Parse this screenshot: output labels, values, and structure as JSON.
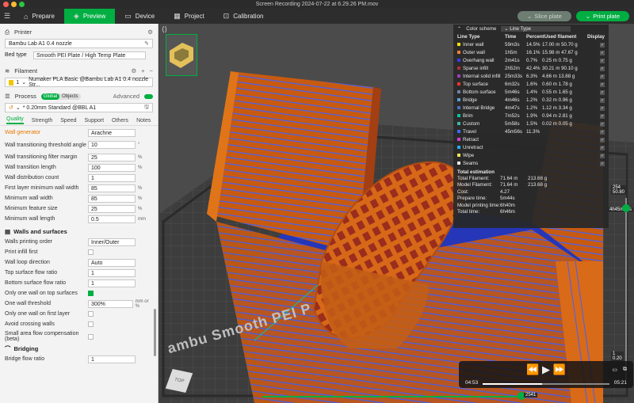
{
  "window": {
    "title": "Screen Recording 2024-07-22 at 6.29.26 PM.mov"
  },
  "tabs": [
    {
      "label": "Prepare",
      "icon": "home-icon"
    },
    {
      "label": "Preview",
      "icon": "cube-icon"
    },
    {
      "label": "Device",
      "icon": "monitor-icon"
    },
    {
      "label": "Project",
      "icon": "project-icon"
    },
    {
      "label": "Calibration",
      "icon": "calibration-icon"
    }
  ],
  "toolbar": {
    "slice_label": "Slice plate",
    "print_label": "Print plate"
  },
  "left": {
    "printer_title": "Printer",
    "printer_value": "Bambu Lab A1 0.4 nozzle",
    "bed_label": "Bed type",
    "bed_value": "Smooth PEI Plate / High Temp Plate",
    "filament_title": "Filament",
    "filament_index": "1",
    "filament_value": "Numaker PLA Basic @Bambu Lab A1 0.4 nozzle Str...",
    "process_title": "Process",
    "process_global": "Global",
    "process_objects": "Objects",
    "advanced": "Advanced",
    "process_profile": "* 0.20mm Standard @BBL A1",
    "subtabs": [
      "Quality",
      "Strength",
      "Speed",
      "Support",
      "Others",
      "Notes"
    ],
    "rows": [
      {
        "label": "Wall generator",
        "value": "Arachne",
        "unit": ""
      },
      {
        "label": "Wall transitioning threshold angle",
        "value": "10",
        "unit": "°"
      },
      {
        "label": "Wall transitioning filter margin",
        "value": "25",
        "unit": "%"
      },
      {
        "label": "Wall transition length",
        "value": "100",
        "unit": "%"
      },
      {
        "label": "Wall distribution count",
        "value": "1",
        "unit": ""
      },
      {
        "label": "First layer minimum wall width",
        "value": "85",
        "unit": "%"
      },
      {
        "label": "Minimum wall width",
        "value": "85",
        "unit": "%"
      },
      {
        "label": "Minimum feature size",
        "value": "25",
        "unit": "%"
      },
      {
        "label": "Minimum wall length",
        "value": "0.5",
        "unit": "mm"
      }
    ],
    "walls_title": "Walls and surfaces",
    "walls_rows": [
      {
        "label": "Walls printing order",
        "value": "Inner/Outer",
        "unit": ""
      },
      {
        "label": "Print infill first",
        "value": "",
        "unit": ""
      },
      {
        "label": "Wall loop direction",
        "value": "Auto",
        "unit": ""
      },
      {
        "label": "Top surface flow ratio",
        "value": "1",
        "unit": ""
      },
      {
        "label": "Bottom surface flow ratio",
        "value": "1",
        "unit": ""
      },
      {
        "label": "Only one wall on top surfaces",
        "value": "",
        "unit": ""
      },
      {
        "label": "One wall threshold",
        "value": "300%",
        "unit": "mm or %"
      },
      {
        "label": "Only one wall on first layer",
        "value": "",
        "unit": ""
      },
      {
        "label": "Avoid crossing walls",
        "value": "",
        "unit": ""
      },
      {
        "label": "Small area flow compensation (beta)",
        "value": "",
        "unit": ""
      }
    ],
    "bridging_title": "Bridging",
    "bridge_flow_label": "Bridge flow ratio",
    "bridge_flow_value": "1"
  },
  "legend": {
    "color_scheme_label": "Color scheme",
    "color_scheme_value": "Line Type",
    "cols": [
      "Line Type",
      "Time",
      "Percent",
      "Used filament",
      "Display"
    ],
    "rows": [
      {
        "name": "Inner wall",
        "time": "59m3s",
        "pct": "14.5%",
        "len": "17.00 m",
        "wt": "50.70 g",
        "color": "#ffe100"
      },
      {
        "name": "Outer wall",
        "time": "1h5m",
        "pct": "16.1%",
        "len": "15.98 m",
        "wt": "47.67 g",
        "color": "#ff7d38"
      },
      {
        "name": "Overhang wall",
        "time": "2m41s",
        "pct": "0.7%",
        "len": "0.25 m",
        "wt": "0.75 g",
        "color": "#3b3bff"
      },
      {
        "name": "Sparse infill",
        "time": "2h52m",
        "pct": "42.4%",
        "len": "30.21 m",
        "wt": "90.10 g",
        "color": "#b0312f"
      },
      {
        "name": "Internal solid infill",
        "time": "25m33s",
        "pct": "6.3%",
        "len": "4.66 m",
        "wt": "13.88 g",
        "color": "#9b3fbf"
      },
      {
        "name": "Top surface",
        "time": "6m32s",
        "pct": "1.6%",
        "len": "0.60 m",
        "wt": "1.78 g",
        "color": "#ff3030"
      },
      {
        "name": "Bottom surface",
        "time": "5m46s",
        "pct": "1.4%",
        "len": "0.55 m",
        "wt": "1.65 g",
        "color": "#6c82a8"
      },
      {
        "name": "Bridge",
        "time": "4m46s",
        "pct": "1.2%",
        "len": "0.32 m",
        "wt": "0.96 g",
        "color": "#55a0d8"
      },
      {
        "name": "Internal Bridge",
        "time": "4m47s",
        "pct": "1.2%",
        "len": "1.12 m",
        "wt": "3.34 g",
        "color": "#4a6fbf"
      },
      {
        "name": "Brim",
        "time": "7m52s",
        "pct": "1.9%",
        "len": "0.94 m",
        "wt": "2.81 g",
        "color": "#00c8a0"
      },
      {
        "name": "Custom",
        "time": "5m58s",
        "pct": "1.5%",
        "len": "0.02 m",
        "wt": "0.05 g",
        "color": "#3fb3a8"
      },
      {
        "name": "Travel",
        "time": "45m56s",
        "pct": "11.3%",
        "len": "",
        "wt": "",
        "color": "#3d6bff"
      },
      {
        "name": "Retract",
        "time": "",
        "pct": "",
        "len": "",
        "wt": "",
        "color": "#d040d0"
      },
      {
        "name": "Unretract",
        "time": "",
        "pct": "",
        "len": "",
        "wt": "",
        "color": "#20b0ff"
      },
      {
        "name": "Wipe",
        "time": "",
        "pct": "",
        "len": "",
        "wt": "",
        "color": "#ffe64d"
      },
      {
        "name": "Seams",
        "time": "",
        "pct": "",
        "len": "",
        "wt": "",
        "color": "#e8e8e8"
      }
    ],
    "estimation_title": "Total estimation",
    "estimation": [
      {
        "k": "Total Filament:",
        "v1": "71.64 m",
        "v2": "213.68 g"
      },
      {
        "k": "Model Filament:",
        "v1": "71.64 m",
        "v2": "213.68 g"
      },
      {
        "k": "Cost:",
        "v1": "4.27",
        "v2": ""
      },
      {
        "k": "Prepare time:",
        "v1": "5m44s",
        "v2": ""
      },
      {
        "k": "Model printing time:",
        "v1": "6h40m",
        "v2": ""
      },
      {
        "k": "Total time:",
        "v1": "6h46m",
        "v2": ""
      }
    ]
  },
  "slider": {
    "top_layer": "254",
    "top_height": "50.80",
    "time_badge": "4h45m52s",
    "bottom_layer": "1",
    "bottom_height": "0.20",
    "horizontal_value": "2541"
  },
  "player": {
    "elapsed": "04:53",
    "remaining": "05:21",
    "progress": 0.47
  },
  "plate_text": "ambu Smooth PEI P",
  "cube_label": "TOP"
}
